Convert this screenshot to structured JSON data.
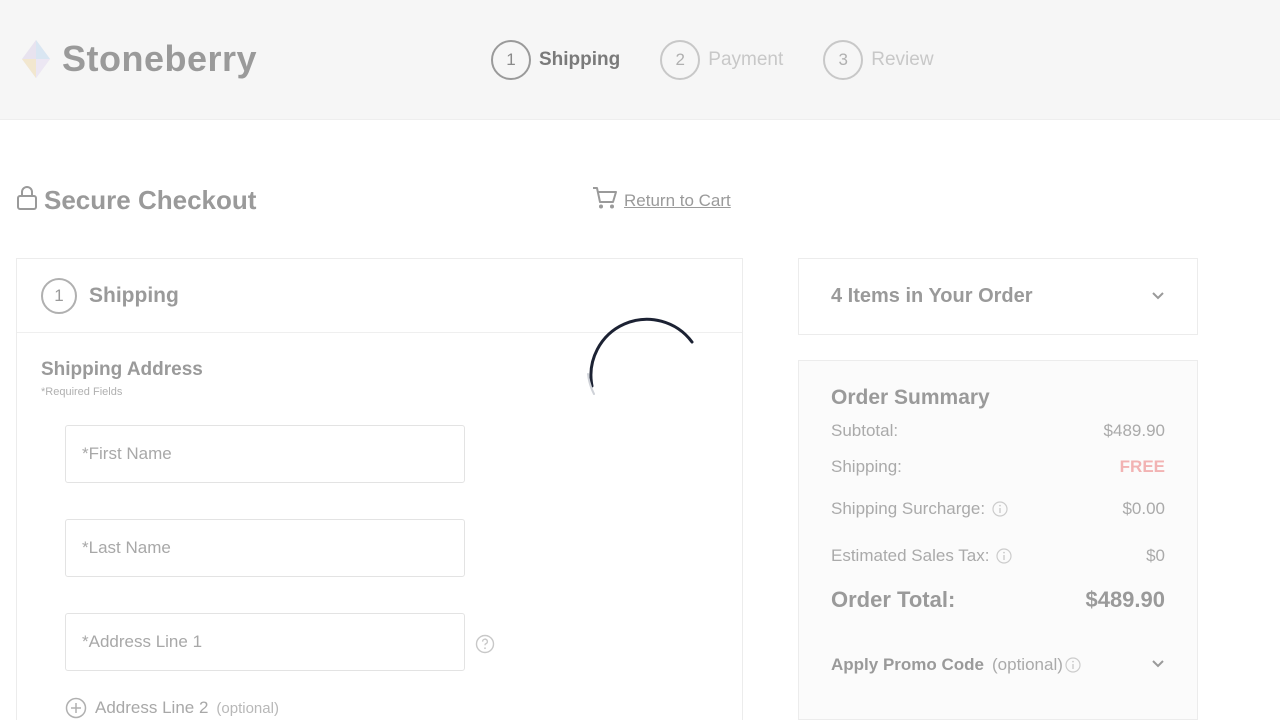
{
  "header": {
    "brand": "Stoneberry",
    "steps": [
      {
        "number": "1",
        "label": "Shipping",
        "active": true
      },
      {
        "number": "2",
        "label": "Payment",
        "active": false
      },
      {
        "number": "3",
        "label": "Review",
        "active": false
      }
    ]
  },
  "page": {
    "title": "Secure Checkout",
    "return_to_cart": "Return to Cart"
  },
  "shipping_panel": {
    "step_number": "1",
    "heading": "Shipping",
    "section_title": "Shipping Address",
    "required_note": "*Required Fields",
    "fields": {
      "first_name_placeholder": "*First Name",
      "last_name_placeholder": "*Last Name",
      "address1_placeholder": "*Address Line 1"
    },
    "address2": {
      "label": "Address Line 2",
      "optional": "(optional)"
    }
  },
  "order": {
    "items_title": "4 Items in Your Order",
    "summary_title": "Order Summary",
    "subtotal_label": "Subtotal:",
    "subtotal_value": "$489.90",
    "shipping_label": "Shipping:",
    "shipping_value": "FREE",
    "surcharge_label": "Shipping Surcharge:",
    "surcharge_value": "$0.00",
    "tax_label": "Estimated Sales Tax:",
    "tax_value": "$0",
    "total_label": "Order Total:",
    "total_value": "$489.90",
    "promo_label": "Apply Promo Code",
    "promo_optional": "(optional)"
  },
  "colors": {
    "free_accent": "#f2b3b3",
    "spinner": "#1c2233"
  },
  "icons": [
    "brand-logo-icon",
    "lock-icon",
    "cart-icon",
    "help-circle-icon",
    "plus-circle-icon",
    "chevron-down-icon",
    "info-icon",
    "loading-spinner-icon"
  ]
}
